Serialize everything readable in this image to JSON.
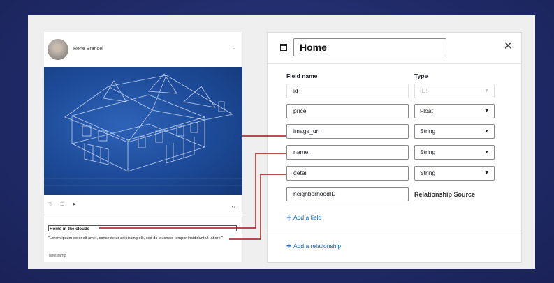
{
  "post": {
    "author": "Rene Brandel",
    "more_icon": "⋮",
    "actions": [
      "♡",
      "☐",
      "➤"
    ],
    "bookmark_icon": "⍽",
    "title": "Home in the clouds",
    "description": "\"Lorem ipsum dolor sit amet, consectetur adipiscing elit, sed do eiusmod tempor incididunt ut labore.\"",
    "timestamp": "Timestamp"
  },
  "editor": {
    "model_name": "Home",
    "close_icon": "✕",
    "col_field": "Field name",
    "col_type": "Type",
    "chevron": "▼",
    "fields": [
      {
        "name": "id",
        "type": "ID!",
        "disabled": true
      },
      {
        "name": "price",
        "type": "Float"
      },
      {
        "name": "image_url",
        "type": "String"
      },
      {
        "name": "name",
        "type": "String"
      },
      {
        "name": "detail",
        "type": "String"
      },
      {
        "name": "neighborhoodID",
        "type": "Relationship Source"
      }
    ],
    "add_field": "Add a field",
    "add_relationship": "Add a relationship",
    "plus": "+"
  },
  "colors": {
    "background": "#232f6e",
    "connector": "#a31515",
    "link": "#0a62b8"
  }
}
